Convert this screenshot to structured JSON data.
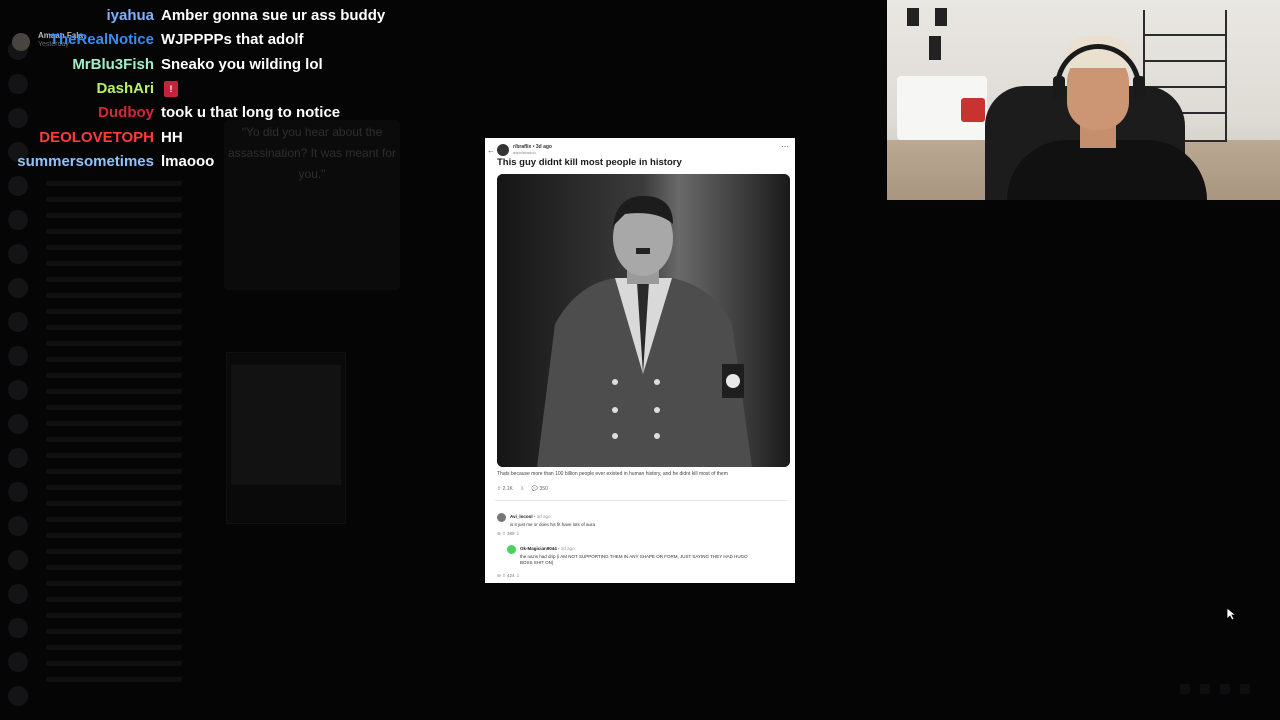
{
  "chat": {
    "messages": [
      {
        "user": "iyahua",
        "color": "#7fb2ff",
        "text": "Amber gonna sue ur ass buddy"
      },
      {
        "user": "TheRealNotice",
        "color": "#3b8cf2",
        "text": "WJPPPPs that adolf"
      },
      {
        "user": "MrBlu3Fish",
        "color": "#9ff0c8",
        "text": "Sneako you wilding lol"
      },
      {
        "user": "DashAri",
        "color": "#b8f26a",
        "text": ""
      },
      {
        "user": "Dudboy",
        "color": "#d22838",
        "text": "took u that long to notice"
      },
      {
        "user": "DEOLOVETOPH",
        "color": "#ff3b3b",
        "text": "HH"
      },
      {
        "user": "summersometimes",
        "color": "#8fc3ff",
        "text": "lmaooo"
      }
    ],
    "emote_icon": "red-emote-icon"
  },
  "reply_ghost": {
    "name": "Amaan Fala",
    "time": "Yesterday"
  },
  "background_app": {
    "quote": "\"Yo did you hear about the assassination? It was meant for you.\""
  },
  "post": {
    "subreddit": "r/braflix",
    "age": "3d ago",
    "author": "adpolitcadoo",
    "title": "This guy didnt kill most people in history",
    "image_alt": "black-and-white portrait photo",
    "body": "Thats because more than 100 billion people ever existed in human history, and he didnt kill most of them",
    "upvotes": "2.1K",
    "comments": "350",
    "comment_list": [
      {
        "user": "Avi_locool",
        "age": "3d ago",
        "text": "is it just me or does his fit have lots of aura",
        "votes": "389",
        "line2": ""
      },
      {
        "user": "Ok-Magician9044",
        "age": "3d ago",
        "text": "the nazis had drip (i AM NOT SUPPORTING THEM IN ANY SHAPE OR FORM, JUST SAYING THEY HAD HUGO",
        "line2": "BOSS SHIT ON)",
        "votes": "424"
      }
    ]
  },
  "colors": {
    "post_bg": "#ffffff",
    "chat_text": "#ffffff",
    "page_bg": "#000000"
  }
}
